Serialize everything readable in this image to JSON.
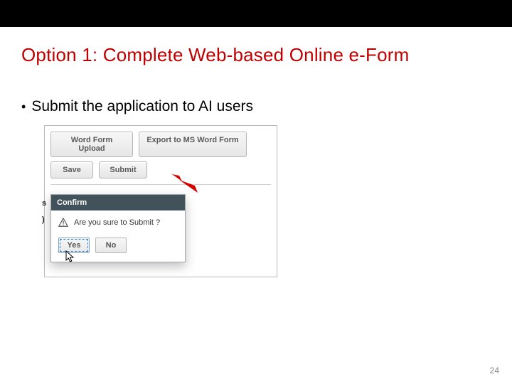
{
  "colors": {
    "title": "#c00000",
    "topbar": "#000000"
  },
  "title": "Option 1: Complete Web-based Online e-Form",
  "bullet": "Submit the application to AI users",
  "toolbar": {
    "word_upload": "Word Form Upload",
    "export_word": "Export to MS Word Form",
    "save": "Save",
    "submit": "Submit"
  },
  "dialog": {
    "title": "Confirm",
    "message": "Are you sure to Submit ?",
    "yes": "Yes",
    "no": "No"
  },
  "side_labels": {
    "s": "s",
    "o": ")"
  },
  "icons": {
    "warning": "warning-icon",
    "cursor": "cursor-icon",
    "red_arrow": "red-arrow-icon"
  },
  "page_number": "24"
}
